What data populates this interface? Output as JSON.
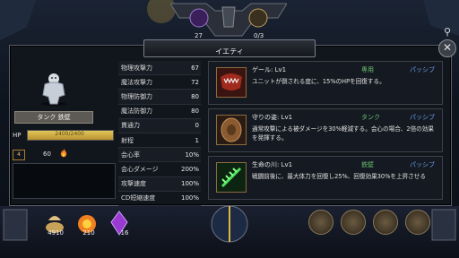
{
  "top": {
    "currency_a": "27",
    "currency_b": "0/3"
  },
  "title": "イエティ",
  "unit": {
    "name": "タンク 鉄壁",
    "hp_label": "HP",
    "hp_text": "2400/2400",
    "hp_fraction": 1.0,
    "level": "4",
    "power": "60"
  },
  "stats": [
    {
      "k": "物理攻撃力",
      "v": "67"
    },
    {
      "k": "魔法攻撃力",
      "v": "72"
    },
    {
      "k": "物理防御力",
      "v": "80"
    },
    {
      "k": "魔法防御力",
      "v": "80"
    },
    {
      "k": "貫通力",
      "v": "0"
    },
    {
      "k": "射程",
      "v": "1"
    },
    {
      "k": "会心率",
      "v": "10%"
    },
    {
      "k": "会心ダメージ",
      "v": "200%"
    },
    {
      "k": "攻撃速度",
      "v": "100%"
    },
    {
      "k": "CD短縮速度",
      "v": "100%"
    }
  ],
  "skills": [
    {
      "name": "ゲール: Lv1",
      "category": "専用",
      "type": "パッシブ",
      "desc": "ユニットが倒される度に、15%のHPを回復する。",
      "icon": "bite-icon"
    },
    {
      "name": "守りの姿: Lv1",
      "category": "タンク",
      "type": "パッシブ",
      "desc": "通常攻撃による被ダメージを30%軽減する。会心の場合、2倍の効果を発揮する。",
      "icon": "shield-icon"
    },
    {
      "name": "生命の川: Lv1",
      "category": "鉄壁",
      "type": "パッシブ",
      "desc": "戦闘前後に、最大体力を回復し25%、回復効果30%を上昇させる",
      "icon": "leaf-icon"
    }
  ],
  "bottom": {
    "gold": "4910",
    "fire": "210",
    "gem": "16"
  },
  "colors": {
    "hp": "#e3c75a",
    "passive": "#6aa0e8",
    "category": "#6cc070"
  }
}
